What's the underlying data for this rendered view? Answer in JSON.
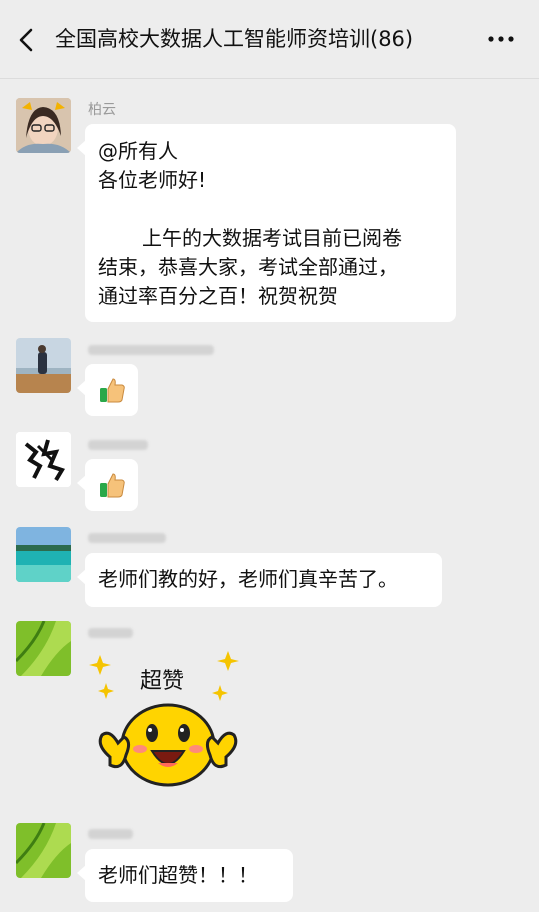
{
  "header": {
    "title": "全国高校大数据人工智能师资培训(86)",
    "back_icon": "back-arrow-icon",
    "more_icon": "more-dots-icon"
  },
  "messages": [
    {
      "sender": "柏云",
      "text_lines": [
        "@所有人",
        "各位老师好!",
        "",
        "上午的大数据考试目前已阅卷",
        "结束，恭喜大家，考试全部通过，",
        "通过率百分之百！祝贺祝贺"
      ]
    },
    {
      "sender": "",
      "emoji": "thumbs-up-icon"
    },
    {
      "sender": "",
      "emoji": "thumbs-up-icon"
    },
    {
      "sender": "",
      "text": "老师们教的好，老师们真辛苦了。"
    },
    {
      "sender": "",
      "sticker_text": "超赞"
    },
    {
      "sender": "",
      "text": "老师们超赞！！！"
    }
  ],
  "colors": {
    "background": "#ededed",
    "bubble": "#ffffff",
    "name_text": "#9a9a9a"
  }
}
